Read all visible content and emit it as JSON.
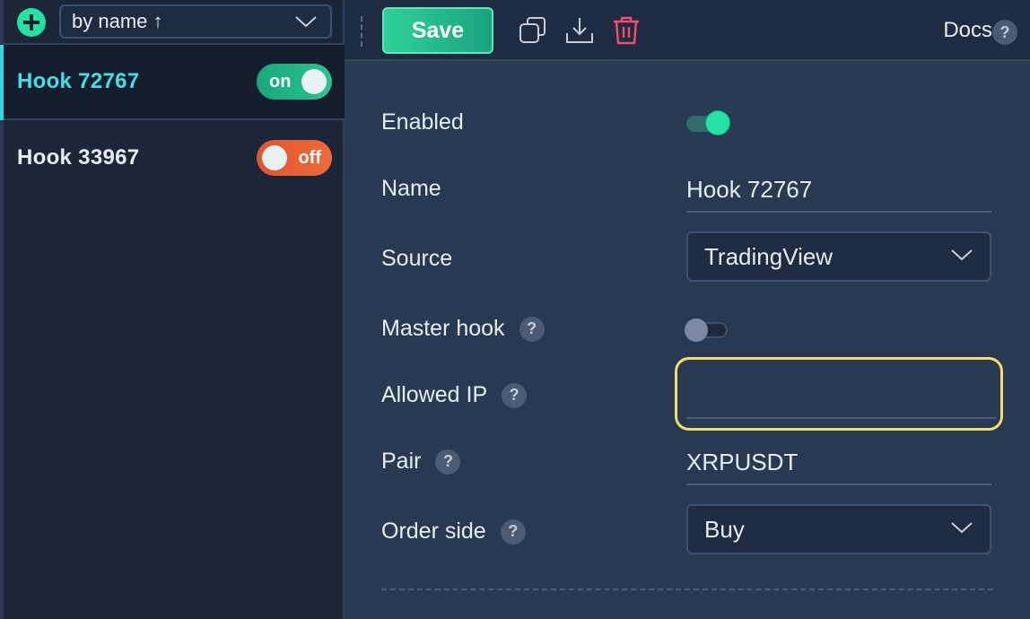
{
  "sidebar": {
    "sort": {
      "label": "by name ↑"
    },
    "hooks": [
      {
        "name": "Hook 72767",
        "state": "on",
        "active": true
      },
      {
        "name": "Hook 33967",
        "state": "off",
        "active": false
      }
    ]
  },
  "toolbar": {
    "save_label": "Save",
    "docs_label": "Docs",
    "help_glyph": "?",
    "icons": [
      "duplicate-icon",
      "download-icon",
      "trash-icon"
    ]
  },
  "form": {
    "enabled": {
      "label": "Enabled",
      "value": true
    },
    "name": {
      "label": "Name",
      "value": "Hook 72767"
    },
    "source": {
      "label": "Source",
      "value": "TradingView"
    },
    "master_hook": {
      "label": "Master hook",
      "value": false
    },
    "allowed_ip": {
      "label": "Allowed IP",
      "value": ""
    },
    "pair": {
      "label": "Pair",
      "value": "XRPUSDT"
    },
    "order_side": {
      "label": "Order side",
      "value": "Buy"
    }
  },
  "colors": {
    "accent_green": "#2bc48e",
    "accent_cyan": "#3fe0e6",
    "off_orange": "#e2552f",
    "focus_yellow": "#f3dd6a",
    "delete_red": "#f0506e"
  }
}
